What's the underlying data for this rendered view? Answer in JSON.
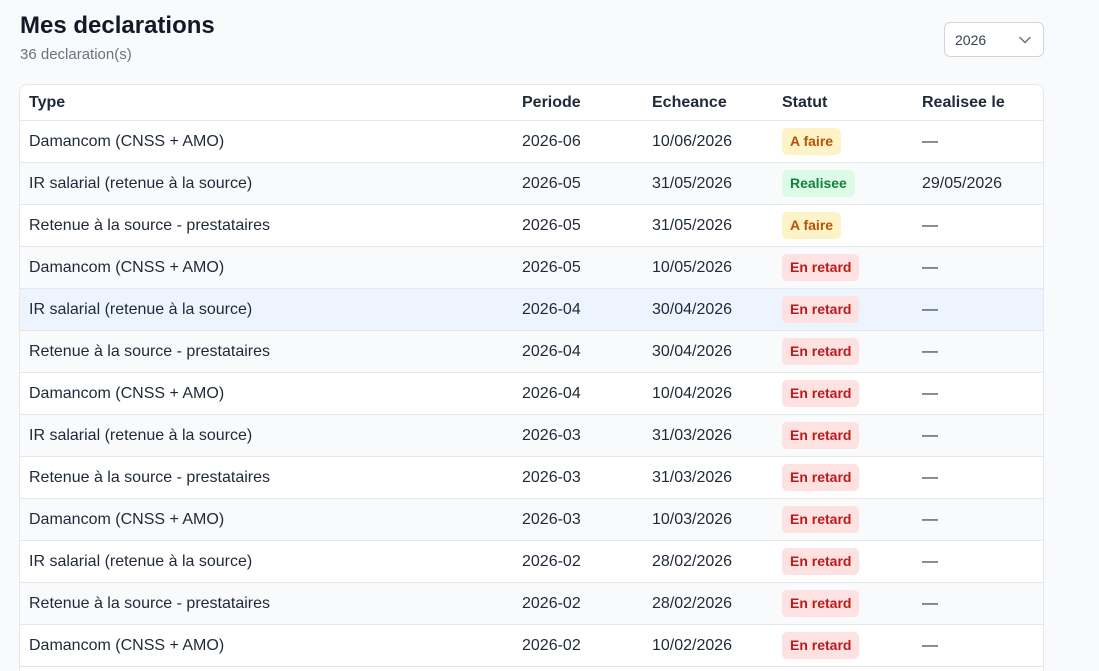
{
  "header": {
    "title": "Mes declarations",
    "count": "36 declaration(s)"
  },
  "year_select": {
    "value": "2026"
  },
  "table": {
    "columns": [
      "Type",
      "Periode",
      "Echeance",
      "Statut",
      "Realisee le"
    ],
    "rows": [
      {
        "type": "Damancom (CNSS + AMO)",
        "periode": "2026-06",
        "echeance": "10/06/2026",
        "statut": "A faire",
        "realisee": "—"
      },
      {
        "type": "IR salarial (retenue à la source)",
        "periode": "2026-05",
        "echeance": "31/05/2026",
        "statut": "Realisee",
        "realisee": "29/05/2026"
      },
      {
        "type": "Retenue à la source - prestataires",
        "periode": "2026-05",
        "echeance": "31/05/2026",
        "statut": "A faire",
        "realisee": "—"
      },
      {
        "type": "Damancom (CNSS + AMO)",
        "periode": "2026-05",
        "echeance": "10/05/2026",
        "statut": "En retard",
        "realisee": "—"
      },
      {
        "type": "IR salarial (retenue à la source)",
        "periode": "2026-04",
        "echeance": "30/04/2026",
        "statut": "En retard",
        "realisee": "—"
      },
      {
        "type": "Retenue à la source - prestataires",
        "periode": "2026-04",
        "echeance": "30/04/2026",
        "statut": "En retard",
        "realisee": "—"
      },
      {
        "type": "Damancom (CNSS + AMO)",
        "periode": "2026-04",
        "echeance": "10/04/2026",
        "statut": "En retard",
        "realisee": "—"
      },
      {
        "type": "IR salarial (retenue à la source)",
        "periode": "2026-03",
        "echeance": "31/03/2026",
        "statut": "En retard",
        "realisee": "—"
      },
      {
        "type": "Retenue à la source - prestataires",
        "periode": "2026-03",
        "echeance": "31/03/2026",
        "statut": "En retard",
        "realisee": "—"
      },
      {
        "type": "Damancom (CNSS + AMO)",
        "periode": "2026-03",
        "echeance": "10/03/2026",
        "statut": "En retard",
        "realisee": "—"
      },
      {
        "type": "IR salarial (retenue à la source)",
        "periode": "2026-02",
        "echeance": "28/02/2026",
        "statut": "En retard",
        "realisee": "—"
      },
      {
        "type": "Retenue à la source - prestataires",
        "periode": "2026-02",
        "echeance": "28/02/2026",
        "statut": "En retard",
        "realisee": "—"
      },
      {
        "type": "Damancom (CNSS + AMO)",
        "periode": "2026-02",
        "echeance": "10/02/2026",
        "statut": "En retard",
        "realisee": "—"
      }
    ]
  },
  "status_colors": {
    "A faire": {
      "bg": "#fef3c7",
      "fg": "#b45309"
    },
    "Realisee": {
      "bg": "#dcfce7",
      "fg": "#15803d"
    },
    "En retard": {
      "bg": "#fee2e2",
      "fg": "#b91c1c"
    }
  }
}
